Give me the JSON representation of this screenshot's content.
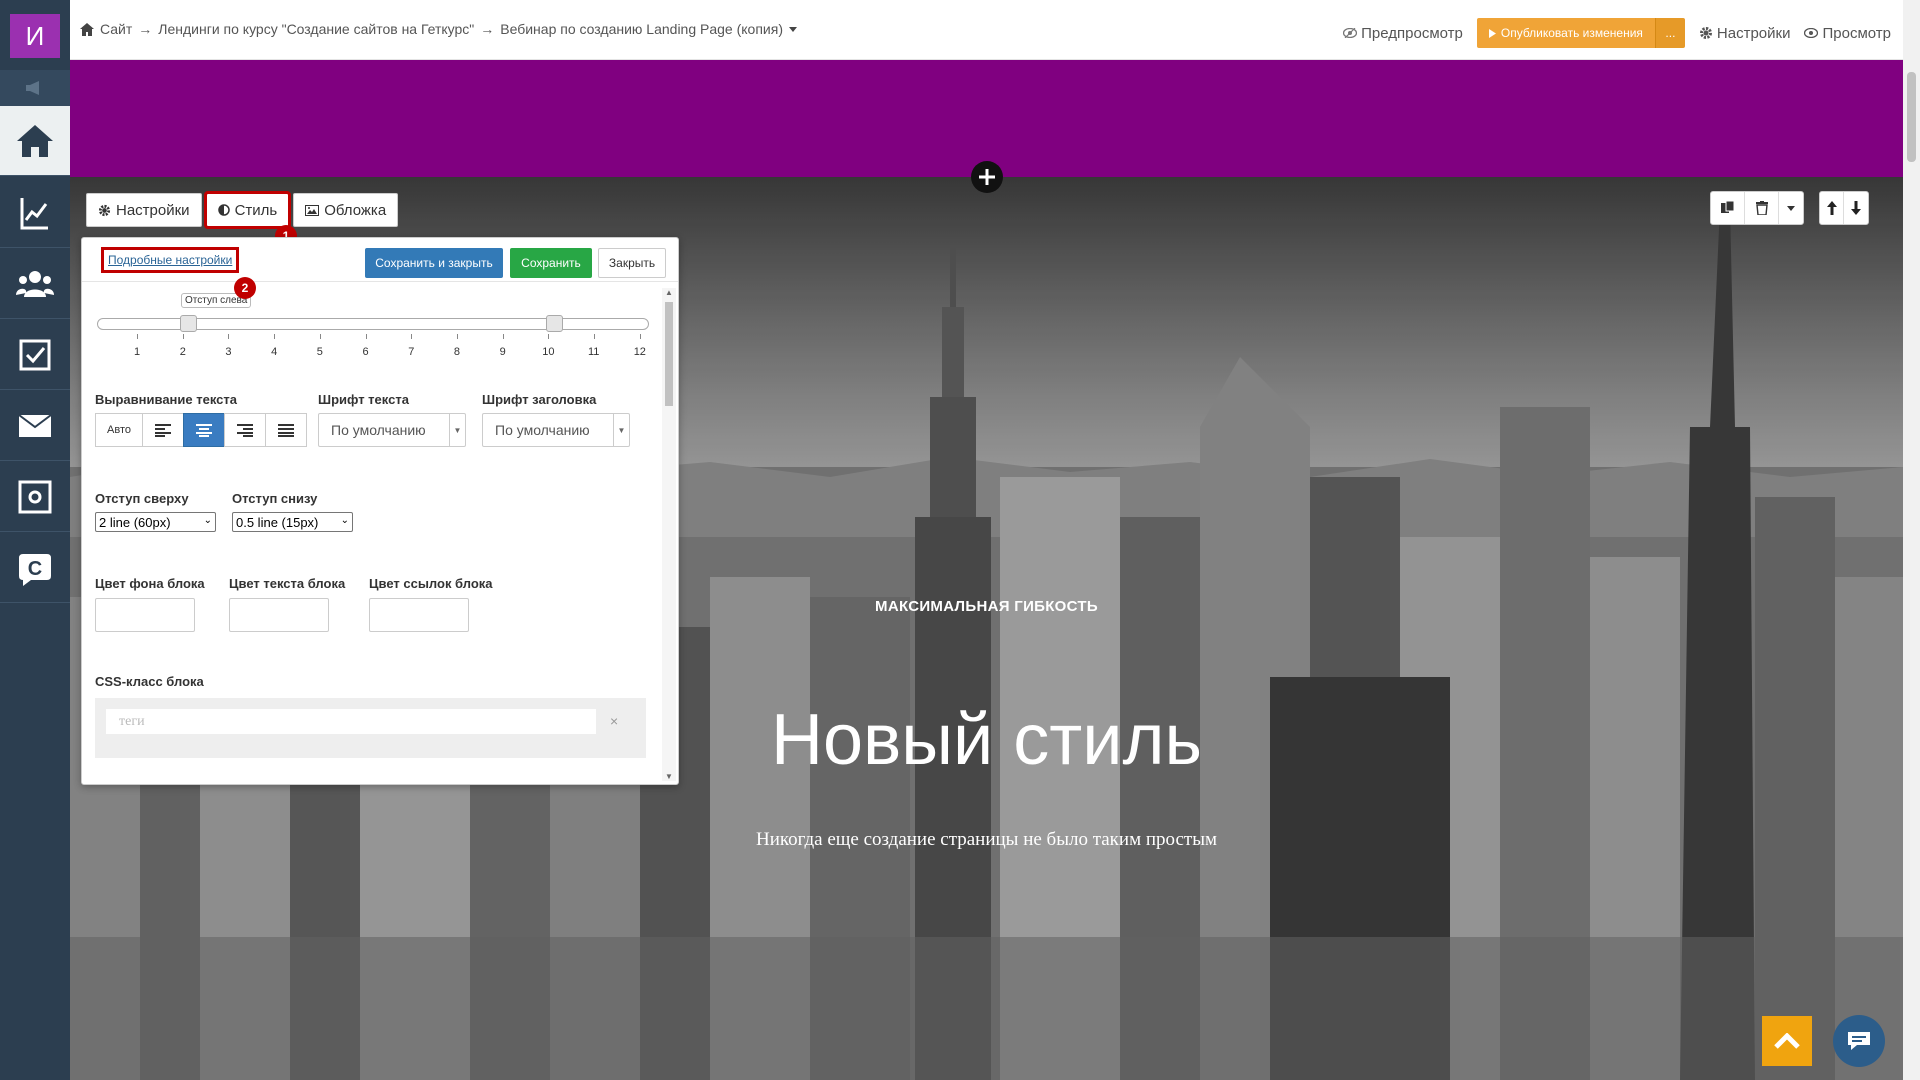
{
  "sidebar": {
    "logo": "И",
    "items": [
      {
        "icon": "home-icon"
      },
      {
        "icon": "chart-icon"
      },
      {
        "icon": "users-icon"
      },
      {
        "icon": "checkbox-icon"
      },
      {
        "icon": "mail-icon"
      },
      {
        "icon": "settings-monitor-icon"
      },
      {
        "icon": "getcourse-icon"
      }
    ]
  },
  "header": {
    "breadcrumb": [
      "Сайт",
      "Лендинги по курсу \"Создание сайтов на Геткурс\"",
      "Вебинар по созданию Landing Page (копия)"
    ],
    "breadcrumb_sep": "→",
    "preview_label": "Предпросмотр",
    "publish_label": "Опубликовать изменения",
    "publish_more": "...",
    "settings_label": "Настройки",
    "view_label": "Просмотр"
  },
  "colors": {
    "accent_purple": "#800080",
    "publish": "#f0a437",
    "highlight": "#c00000",
    "primary": "#337ab7",
    "success": "#28a745"
  },
  "tabs": [
    {
      "label": "Настройки",
      "icon": "gear-icon"
    },
    {
      "label": "Стиль",
      "icon": "contrast-icon"
    },
    {
      "label": "Обложка",
      "icon": "image-icon"
    }
  ],
  "badges": {
    "one": "1",
    "two": "2"
  },
  "panel": {
    "advanced_link": "Подробные настройки",
    "save_close": "Сохранить и закрыть",
    "save": "Сохранить",
    "close": "Закрыть",
    "slider_tooltip": "Отступ слева",
    "slider_left_value": 2,
    "slider_right_value": 10,
    "ticks": [
      "1",
      "2",
      "3",
      "4",
      "5",
      "6",
      "7",
      "8",
      "9",
      "10",
      "11",
      "12"
    ],
    "text_align_label": "Выравнивание текста",
    "align_auto": "Авто",
    "text_font_label": "Шрифт текста",
    "text_font_value": "По умолчанию",
    "heading_font_label": "Шрифт заголовка",
    "heading_font_value": "По умолчанию",
    "padding_top_label": "Отступ сверху",
    "padding_top_value": "2 line (60px)",
    "padding_bottom_label": "Отступ снизу",
    "padding_bottom_value": "0.5 line (15px)",
    "bg_color_label": "Цвет фона блока",
    "text_color_label": "Цвет текста блока",
    "link_color_label": "Цвет ссылок блока",
    "css_class_label": "CSS-класс блока",
    "tags_placeholder": "теги",
    "tags_clear": "×"
  },
  "hero": {
    "kicker": "МАКСИМАЛЬНАЯ ГИБКОСТЬ",
    "title": "Новый стиль",
    "subtitle": "Никогда еще создание страницы не было таким простым"
  }
}
